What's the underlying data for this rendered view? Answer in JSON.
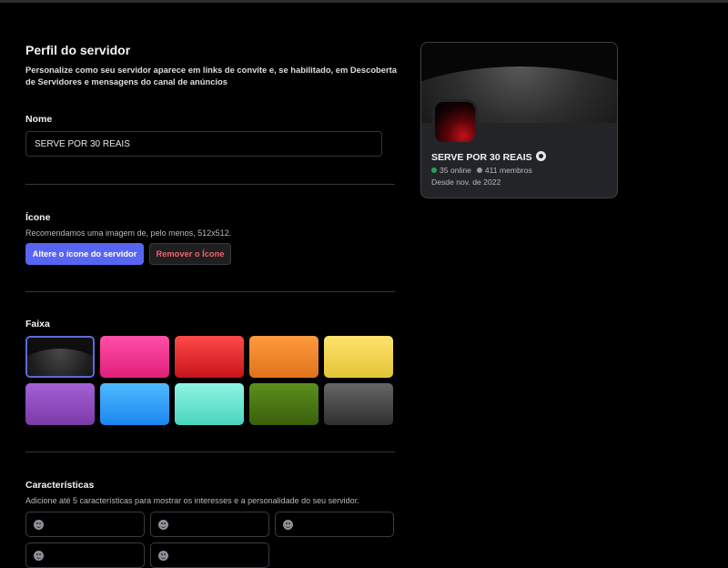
{
  "page": {
    "title": "Perfil do servidor",
    "description": "Personalize como seu servidor aparece em links de convite e, se habilitado, em Descoberta de Servidores e mensagens do canal de anúncios"
  },
  "name_section": {
    "label": "Nome",
    "value": "SERVE POR 30 REAIS"
  },
  "icon_section": {
    "label": "Ícone",
    "hint": "Recomendamos uma imagem de, pelo menos, 512x512.",
    "change_button": "Altere o ícone do servidor",
    "remove_button": "Remover o Ícone"
  },
  "banner_section": {
    "label": "Faixa",
    "swatches": [
      {
        "id": "dark",
        "color": "#111111",
        "selected": true
      },
      {
        "id": "pink",
        "color": "#ff4fa8"
      },
      {
        "id": "red",
        "color": "#ff4a4a"
      },
      {
        "id": "orange",
        "color": "#ff9a3d"
      },
      {
        "id": "yellow",
        "color": "#ffe36b"
      },
      {
        "id": "purple",
        "color": "#a460d6"
      },
      {
        "id": "blue",
        "color": "#4fbaff"
      },
      {
        "id": "teal",
        "color": "#8ff5e3"
      },
      {
        "id": "green",
        "color": "#5c8f1d"
      },
      {
        "id": "gray",
        "color": "#666666"
      }
    ]
  },
  "traits_section": {
    "label": "Características",
    "hint": "Adicione até 5 características para mostrar os interesses e a personalidade do seu servidor.",
    "slots": 5,
    "icon": "emoji-smile-icon"
  },
  "preview": {
    "server_name": "SERVE POR 30 REAIS",
    "online": "35 online",
    "members": "411 membros",
    "since": "Desde nov. de 2022",
    "badge_icon": "gear-icon"
  },
  "colors": {
    "accent": "#5865f2",
    "danger": "#f26269",
    "online": "#23a55a"
  }
}
